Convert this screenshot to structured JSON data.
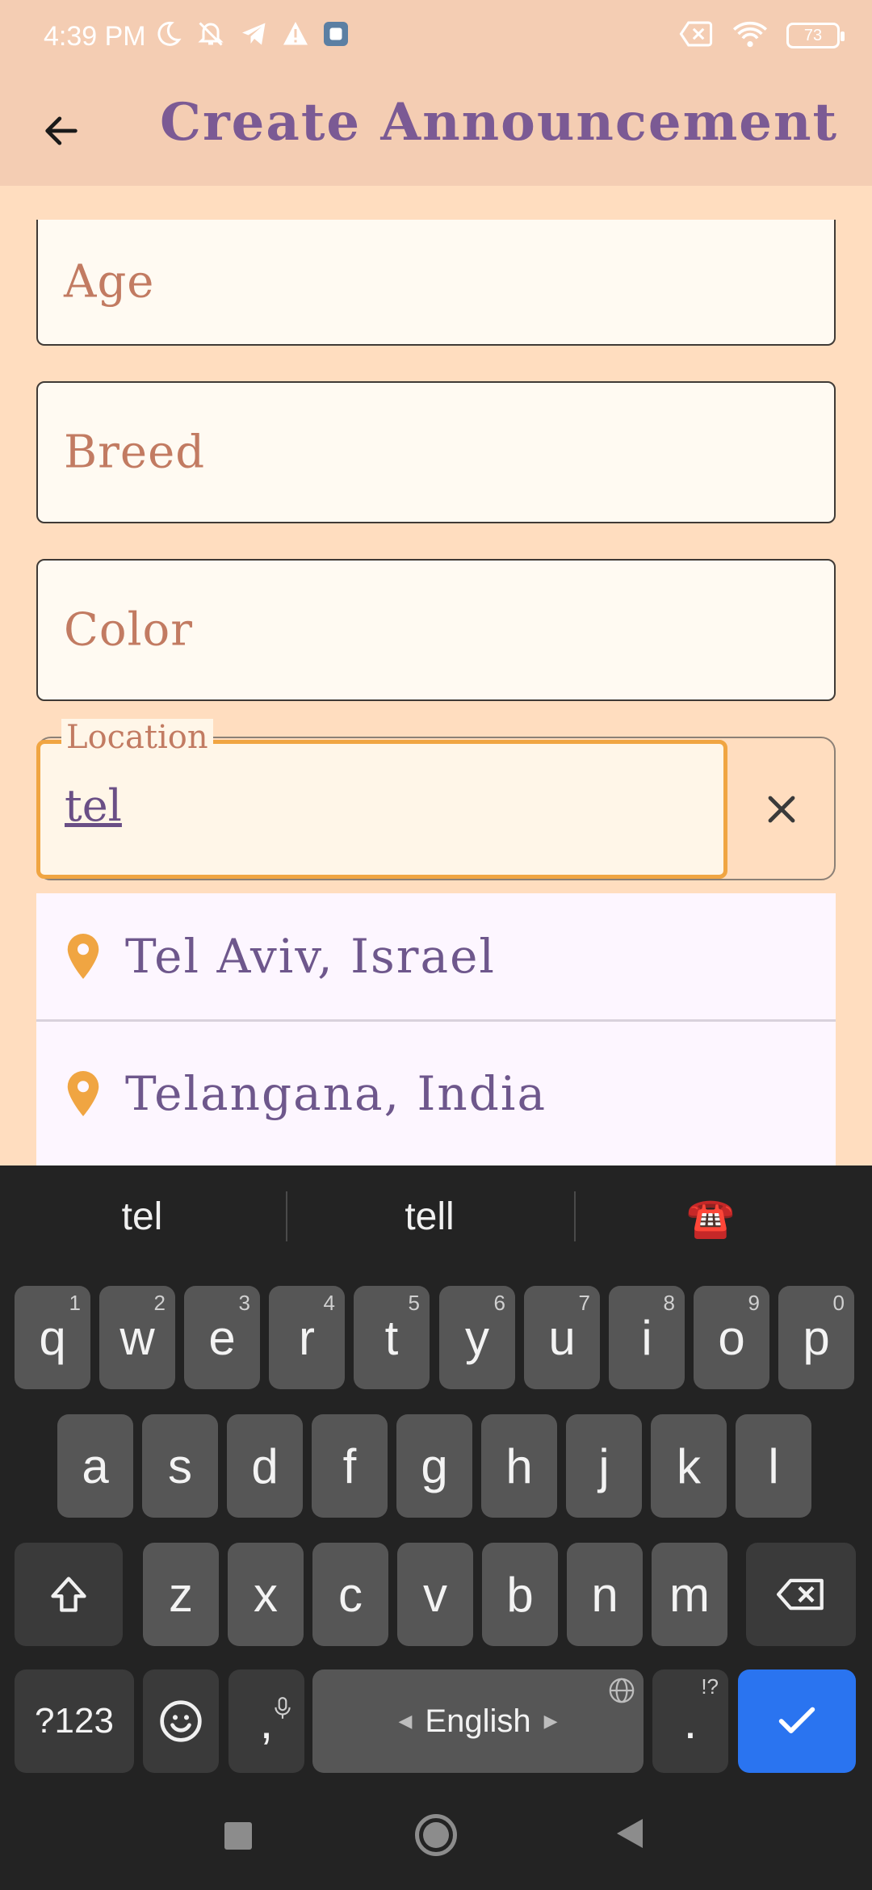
{
  "status_bar": {
    "time": "4:39 PM",
    "battery": "73"
  },
  "app_bar": {
    "title": "Create Announcement",
    "back_icon": "arrow-left-icon"
  },
  "form": {
    "age_placeholder": "Age",
    "breed_placeholder": "Breed",
    "color_placeholder": "Color",
    "location_label": "Location",
    "location_value": "tel"
  },
  "suggestions": [
    {
      "label": "Tel Aviv, Israel",
      "icon": "location-pin-icon"
    },
    {
      "label": "Telangana, India",
      "icon": "location-pin-icon"
    }
  ],
  "keyboard": {
    "suggestions": [
      "tel",
      "tell",
      "☎️"
    ],
    "row1": [
      {
        "k": "q",
        "n": "1"
      },
      {
        "k": "w",
        "n": "2"
      },
      {
        "k": "e",
        "n": "3"
      },
      {
        "k": "r",
        "n": "4"
      },
      {
        "k": "t",
        "n": "5"
      },
      {
        "k": "y",
        "n": "6"
      },
      {
        "k": "u",
        "n": "7"
      },
      {
        "k": "i",
        "n": "8"
      },
      {
        "k": "o",
        "n": "9"
      },
      {
        "k": "p",
        "n": "0"
      }
    ],
    "row2": [
      "a",
      "s",
      "d",
      "f",
      "g",
      "h",
      "j",
      "k",
      "l"
    ],
    "row3": [
      "z",
      "x",
      "c",
      "v",
      "b",
      "n",
      "m"
    ],
    "symbols_label": "?123",
    "comma": ",",
    "space_label": "English",
    "period": ".",
    "period_hint": "!?"
  },
  "colors": {
    "accent": "#F0A542",
    "title": "#7B5A94",
    "enter_key": "#2A74F0"
  }
}
